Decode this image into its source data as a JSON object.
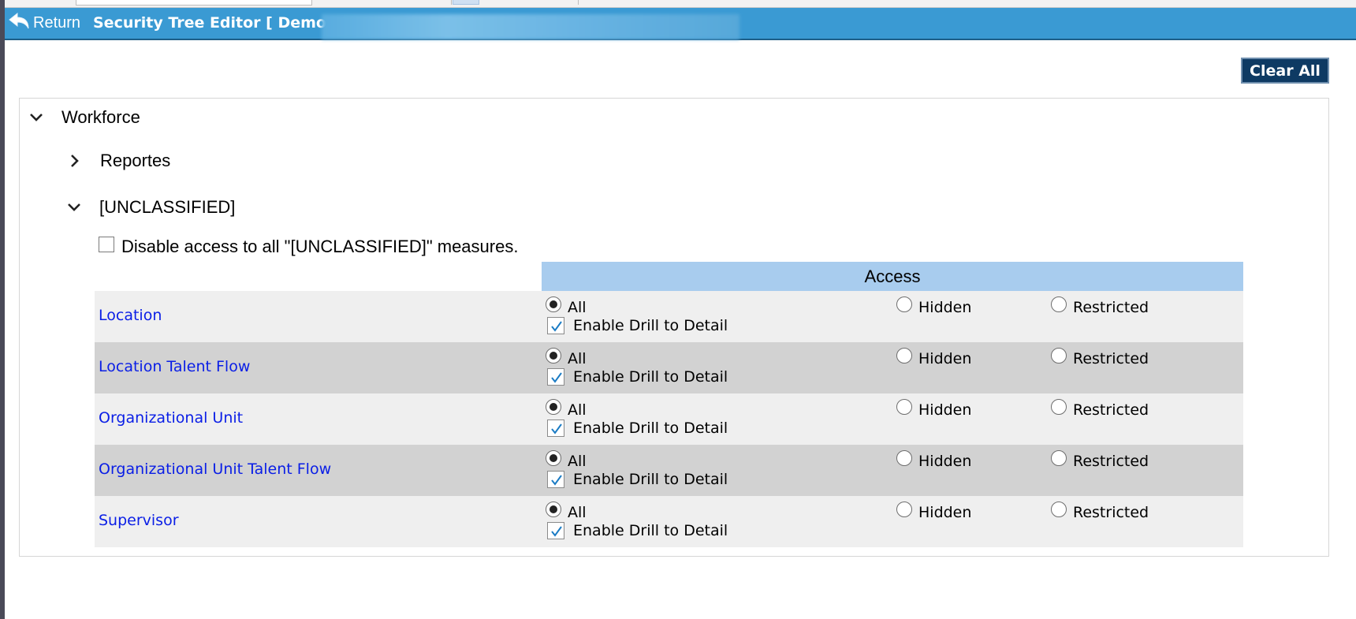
{
  "header": {
    "return_label": "Return",
    "title": "Security Tree Editor [ Demo"
  },
  "toolbar": {
    "clear_all_label": "Clear All"
  },
  "tree": {
    "root_label": "Workforce",
    "nodes": [
      {
        "label": "Reportes",
        "expanded": false
      },
      {
        "label": "[UNCLASSIFIED]",
        "expanded": true
      }
    ],
    "disable_access_label": "Disable access to all \"[UNCLASSIFIED]\" measures.",
    "disable_access_checked": false
  },
  "access_table": {
    "header": "Access",
    "option_all": "All",
    "option_hidden": "Hidden",
    "option_restricted": "Restricted",
    "drill_label": "Enable Drill to Detail",
    "rows": [
      {
        "name": "Location",
        "selected": "All",
        "drill": true
      },
      {
        "name": "Location Talent Flow",
        "selected": "All",
        "drill": true
      },
      {
        "name": "Organizational Unit",
        "selected": "All",
        "drill": true
      },
      {
        "name": "Organizational Unit Talent Flow",
        "selected": "All",
        "drill": true
      },
      {
        "name": "Supervisor",
        "selected": "All",
        "drill": true
      }
    ]
  },
  "colors": {
    "header_bg": "#3a9ad3",
    "clear_all_bg": "#0e3a63",
    "access_header_bg": "#a8ccee",
    "link": "#0a1ee6"
  },
  "icons": {
    "return": "return-arrow-icon",
    "expand": "chevron-down-icon",
    "collapse": "chevron-right-icon",
    "check": "check-icon"
  }
}
